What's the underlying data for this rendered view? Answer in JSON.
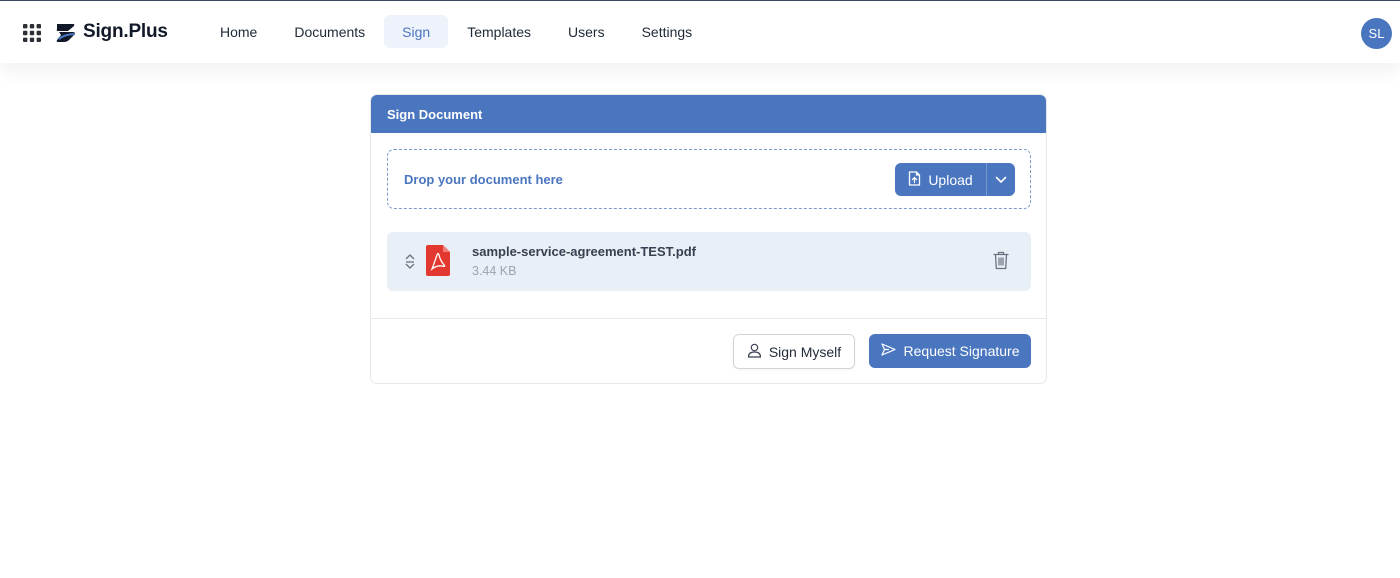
{
  "header": {
    "brand": "Sign.Plus",
    "nav": [
      {
        "label": "Home"
      },
      {
        "label": "Documents"
      },
      {
        "label": "Sign",
        "active": true
      },
      {
        "label": "Templates"
      },
      {
        "label": "Users"
      },
      {
        "label": "Settings"
      }
    ],
    "avatar_initials": "SL"
  },
  "card": {
    "title": "Sign Document",
    "dropzone_text": "Drop your document here",
    "upload_label": "Upload",
    "file": {
      "name": "sample-service-agreement-TEST.pdf",
      "size": "3.44 KB"
    },
    "sign_myself_label": "Sign Myself",
    "request_signature_label": "Request Signature"
  },
  "icons": {
    "apps": "grid-icon",
    "upload": "file-upload-icon",
    "dropdown": "chevron-down-icon",
    "drag": "sort-handle-icon",
    "file_type": "pdf-icon",
    "delete": "trash-icon",
    "sign_myself": "user-icon",
    "request": "send-icon"
  },
  "colors": {
    "primary": "#4a76bf",
    "active_nav_bg": "#eef3fb",
    "file_row_bg": "#e9eff7",
    "pdf_red": "#e2382f"
  }
}
